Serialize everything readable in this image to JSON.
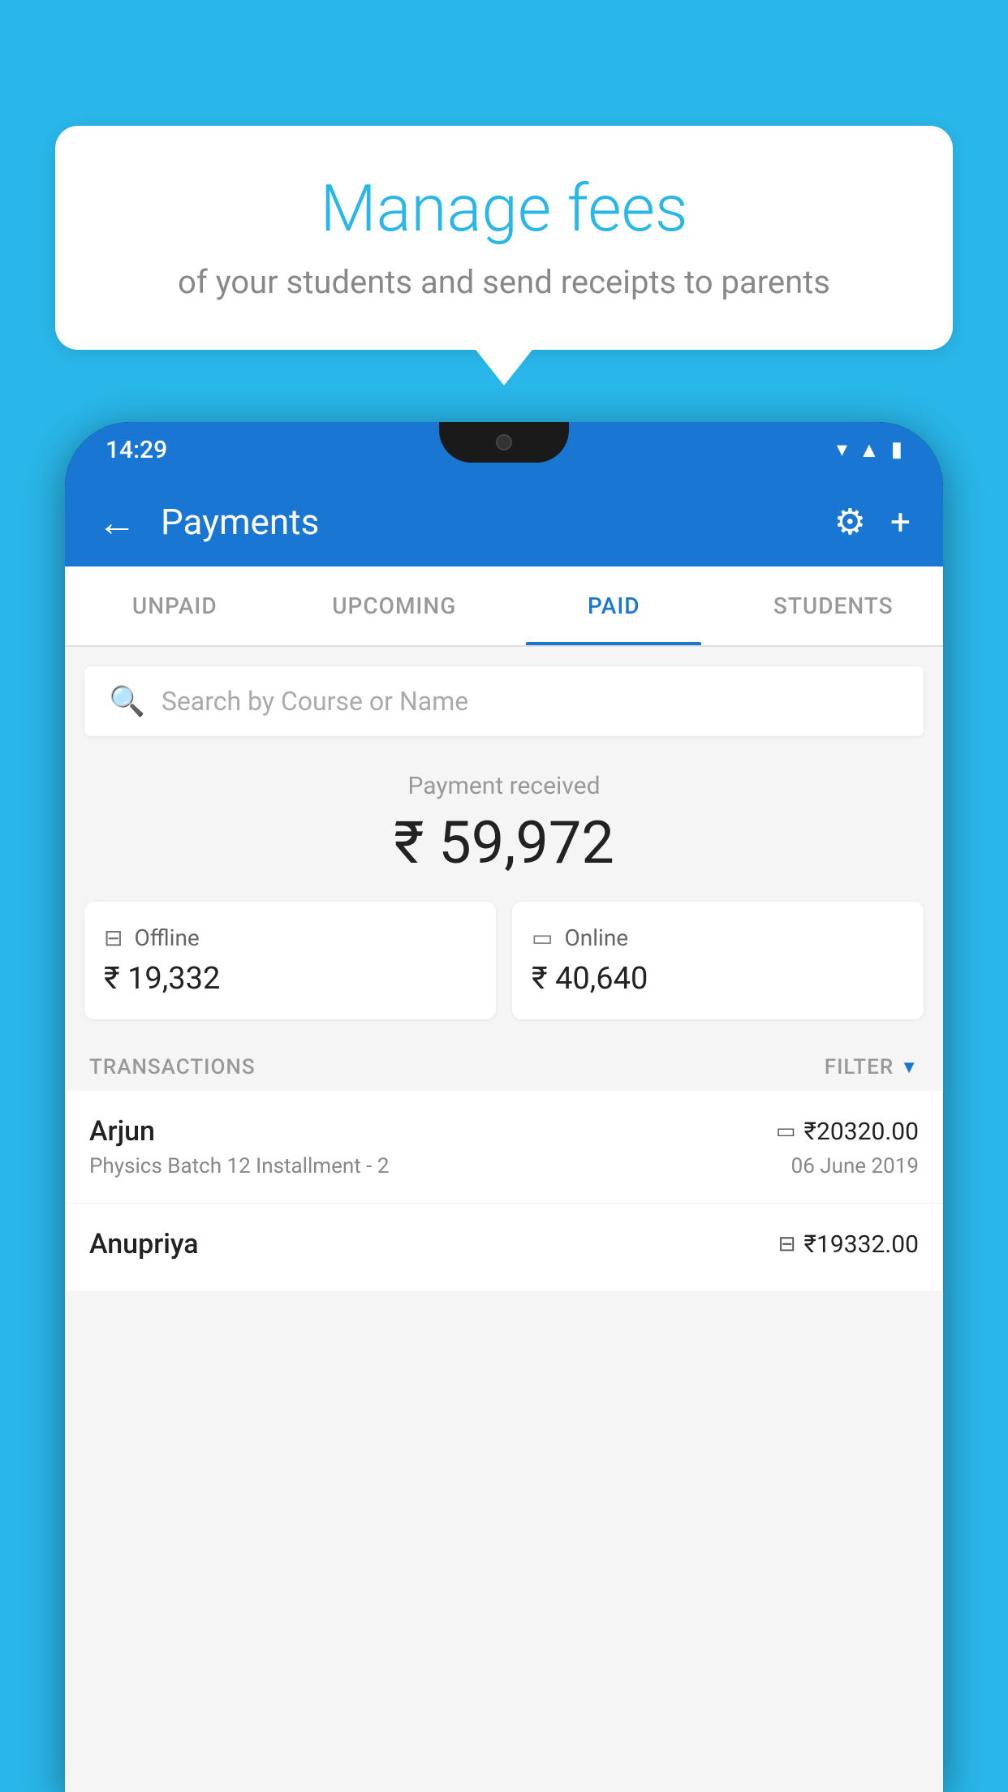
{
  "page": {
    "background_color": "#29b6e8"
  },
  "bubble": {
    "title": "Manage fees",
    "subtitle": "of your students and send receipts to parents"
  },
  "status_bar": {
    "time": "14:29",
    "icons": [
      "wifi",
      "signal",
      "battery"
    ]
  },
  "app_bar": {
    "title": "Payments",
    "back_label": "←",
    "settings_label": "⚙",
    "add_label": "+"
  },
  "tabs": [
    {
      "label": "UNPAID",
      "active": false
    },
    {
      "label": "UPCOMING",
      "active": false
    },
    {
      "label": "PAID",
      "active": true
    },
    {
      "label": "STUDENTS",
      "active": false
    }
  ],
  "search": {
    "placeholder": "Search by Course or Name"
  },
  "payment_received": {
    "label": "Payment received",
    "amount": "₹ 59,972"
  },
  "payment_cards": [
    {
      "type": "Offline",
      "amount": "₹ 19,332",
      "icon": "offline"
    },
    {
      "type": "Online",
      "amount": "₹ 40,640",
      "icon": "online"
    }
  ],
  "transactions_header": {
    "label": "TRANSACTIONS",
    "filter_label": "FILTER"
  },
  "transactions": [
    {
      "name": "Arjun",
      "course": "Physics Batch 12 Installment - 2",
      "amount": "₹20320.00",
      "date": "06 June 2019",
      "payment_type": "online"
    },
    {
      "name": "Anupriya",
      "course": "",
      "amount": "₹19332.00",
      "date": "",
      "payment_type": "offline"
    }
  ]
}
